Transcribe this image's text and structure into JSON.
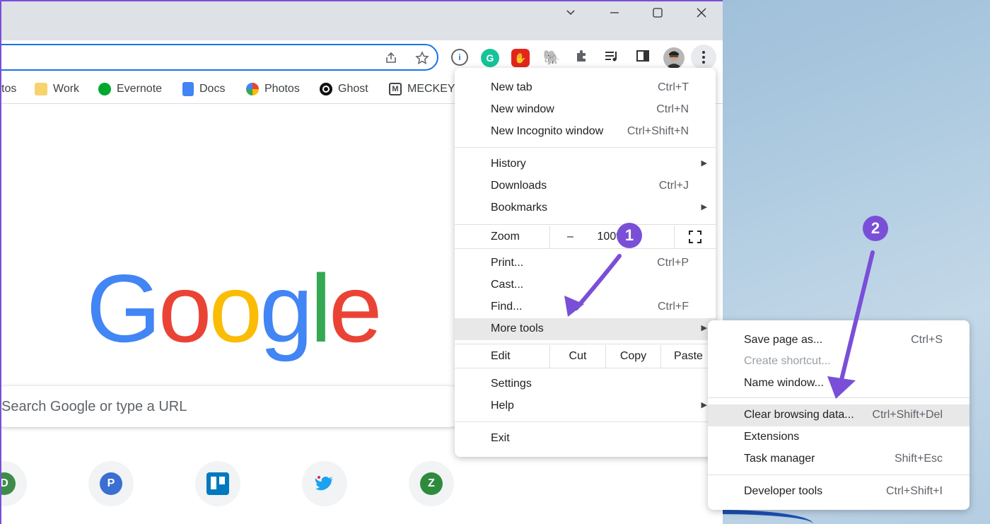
{
  "bookmarks": {
    "items": [
      {
        "label": "tos",
        "icon": "photos-icon"
      },
      {
        "label": "Work",
        "icon": "folder-icon"
      },
      {
        "label": "Evernote",
        "icon": "evernote-icon"
      },
      {
        "label": "Docs",
        "icon": "docs-icon"
      },
      {
        "label": "Photos",
        "icon": "google-photos-icon"
      },
      {
        "label": "Ghost",
        "icon": "ghost-icon"
      },
      {
        "label": "MECKEYS",
        "icon": "meckeys-icon"
      }
    ]
  },
  "page": {
    "logo": [
      "G",
      "o",
      "o",
      "g",
      "l",
      "e"
    ],
    "logo_colors": [
      "#4285f4",
      "#ea4335",
      "#fbbc05",
      "#4285f4",
      "#34a853",
      "#ea4335"
    ],
    "search_placeholder": "Search Google or type a URL",
    "shortcut_tiles": [
      {
        "letter": "D",
        "color": "#3c8d4a"
      },
      {
        "letter": "P",
        "color": "#3b6fd1"
      },
      {
        "letter": "",
        "color": "#0079bf",
        "icon": "trello-icon"
      },
      {
        "letter": "",
        "color": "#1da1f2",
        "icon": "twitter-icon"
      },
      {
        "letter": "Z",
        "color": "#2e8b3d"
      }
    ]
  },
  "menu": {
    "new_tab": {
      "label": "New tab",
      "shortcut": "Ctrl+T"
    },
    "new_window": {
      "label": "New window",
      "shortcut": "Ctrl+N"
    },
    "new_incognito": {
      "label": "New Incognito window",
      "shortcut": "Ctrl+Shift+N"
    },
    "history": {
      "label": "History"
    },
    "downloads": {
      "label": "Downloads",
      "shortcut": "Ctrl+J"
    },
    "bookmarks": {
      "label": "Bookmarks"
    },
    "zoom": {
      "label": "Zoom",
      "minus": "–",
      "value": "100%",
      "plus": "+"
    },
    "print": {
      "label": "Print...",
      "shortcut": "Ctrl+P"
    },
    "cast": {
      "label": "Cast..."
    },
    "find": {
      "label": "Find...",
      "shortcut": "Ctrl+F"
    },
    "more_tools": {
      "label": "More tools"
    },
    "edit": {
      "label": "Edit",
      "cut": "Cut",
      "copy": "Copy",
      "paste": "Paste"
    },
    "settings": {
      "label": "Settings"
    },
    "help": {
      "label": "Help"
    },
    "exit": {
      "label": "Exit"
    }
  },
  "submenu": {
    "save_page": {
      "label": "Save page as...",
      "shortcut": "Ctrl+S"
    },
    "create_shortcut": {
      "label": "Create shortcut..."
    },
    "name_window": {
      "label": "Name window..."
    },
    "clear_browsing": {
      "label": "Clear browsing data...",
      "shortcut": "Ctrl+Shift+Del"
    },
    "extensions": {
      "label": "Extensions"
    },
    "task_manager": {
      "label": "Task manager",
      "shortcut": "Shift+Esc"
    },
    "developer_tools": {
      "label": "Developer tools",
      "shortcut": "Ctrl+Shift+I"
    }
  },
  "annotations": {
    "step1": "1",
    "step2": "2",
    "color": "#7a4fd8"
  }
}
